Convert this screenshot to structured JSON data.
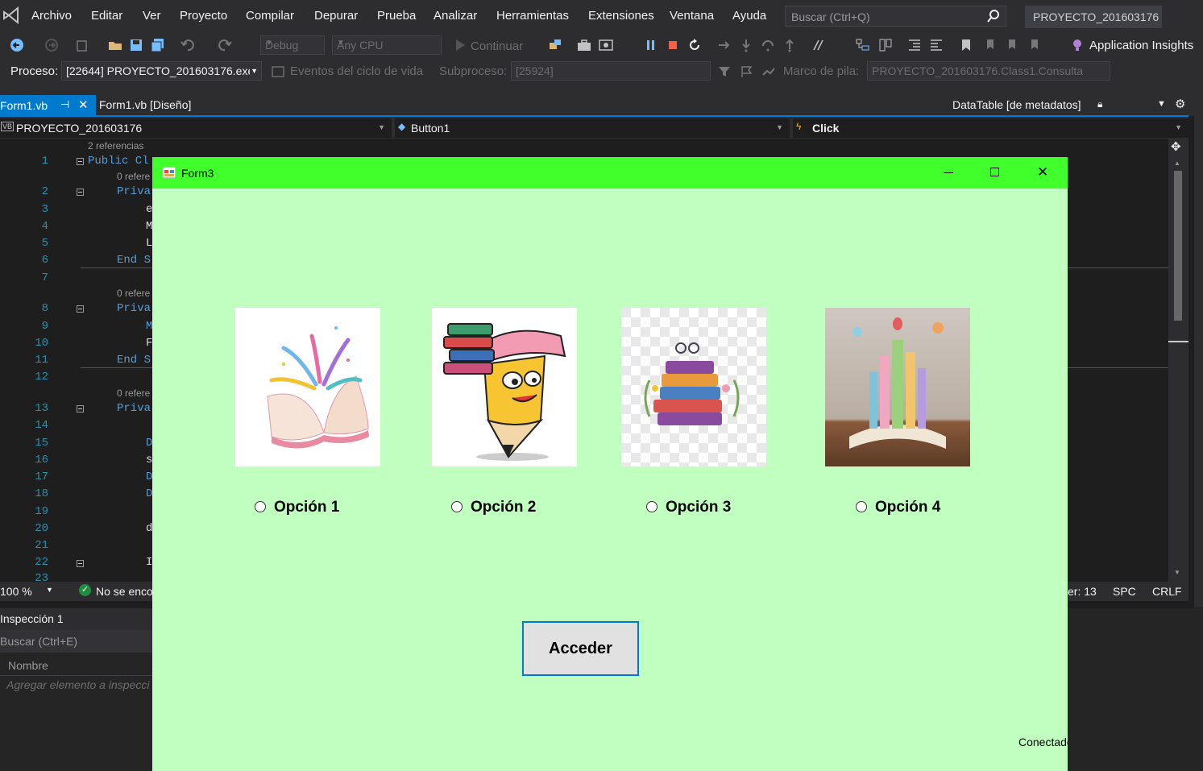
{
  "menu": {
    "items": [
      "Archivo",
      "Editar",
      "Ver",
      "Proyecto",
      "Compilar",
      "Depurar",
      "Prueba",
      "Analizar",
      "Herramientas",
      "Extensiones",
      "Ventana",
      "Ayuda"
    ],
    "search_placeholder": "Buscar (Ctrl+Q)",
    "project_name": "PROYECTO_201603176"
  },
  "toolbar": {
    "config": "Debug",
    "platform": "Any CPU",
    "continue_label": "Continuar",
    "app_insights": "Application Insights"
  },
  "process_bar": {
    "process_label": "Proceso:",
    "process_value": "[22644] PROYECTO_201603176.exe",
    "lifecycle_events": "Eventos del ciclo de vida",
    "thread_label": "Subproceso:",
    "thread_value": "[25924]",
    "stack_label": "Marco de pila:",
    "stack_value": "PROYECTO_201603176.Class1.Consulta"
  },
  "tabs": {
    "active": "Form1.vb",
    "design": "Form1.vb [Diseño]",
    "metadata": "DataTable [de metadatos]"
  },
  "navbar": {
    "project": "PROYECTO_201603176",
    "object": "Button1",
    "event": "Click"
  },
  "editor": {
    "ref_top": "2 referencias",
    "ref_zero": "0 refere",
    "lines": [
      "1",
      "2",
      "3",
      "4",
      "5",
      "6",
      "7",
      "8",
      "9",
      "10",
      "11",
      "12",
      "13",
      "14",
      "15",
      "16",
      "17",
      "18",
      "19",
      "20",
      "21",
      "22",
      "23"
    ],
    "code": {
      "l1": "Public Cl",
      "l2": "Priva",
      "l3": "e",
      "l4": "M",
      "l5": "L",
      "l6": "End S",
      "l8": "Priva",
      "l9": "M",
      "l10": "F",
      "l11": "End S",
      "l13": "Priva",
      "l15": "D",
      "l16": "s",
      "l17": "D",
      "l18": "D",
      "l20": "d",
      "l22": "I"
    }
  },
  "status": {
    "zoom": "100 %",
    "issues": "No se enco",
    "col": "er: 13",
    "spc": "SPC",
    "crlf": "CRLF"
  },
  "watch": {
    "title": "Inspección 1",
    "search": "Buscar (Ctrl+E)",
    "col_name": "Nombre",
    "add_item": "Agregar elemento a inspecci"
  },
  "form3": {
    "title": "Form3",
    "options": [
      "Opción 1",
      "Opción 2",
      "Opción 3",
      "Opción 4"
    ],
    "button": "Acceder",
    "status": "Conectado"
  },
  "colors": {
    "form_bg": "#c0ffc0",
    "form_title": "#40ff2a",
    "accent": "#007acc"
  }
}
